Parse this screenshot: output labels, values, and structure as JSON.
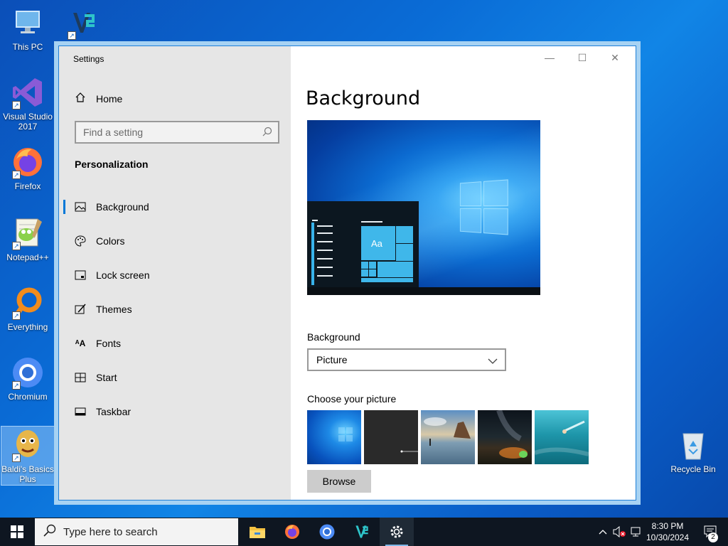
{
  "desktop": {
    "icons": [
      {
        "label": "This PC",
        "icon": "this-pc-icon"
      },
      {
        "label": "Quark",
        "icon": "quark-app-icon"
      },
      {
        "label": "Visual Studio 2017",
        "icon": "visual-studio-icon"
      },
      {
        "label": "Firefox",
        "icon": "firefox-icon"
      },
      {
        "label": "Notepad++",
        "icon": "notepadpp-icon"
      },
      {
        "label": "Everything",
        "icon": "everything-icon"
      },
      {
        "label": "Chromium",
        "icon": "chromium-icon"
      },
      {
        "label": "Baldi's Basics Plus",
        "icon": "baldi-icon"
      },
      {
        "label": "Recycle Bin",
        "icon": "recycle-bin-icon"
      }
    ]
  },
  "window": {
    "app_title": "Settings",
    "controls": {
      "minimize": "—",
      "maximize": "☐",
      "close": "✕"
    }
  },
  "sidebar": {
    "home_label": "Home",
    "search_placeholder": "Find a setting",
    "section_title": "Personalization",
    "items": [
      {
        "label": "Background",
        "icon": "picture-icon",
        "active": true
      },
      {
        "label": "Colors",
        "icon": "palette-icon",
        "active": false
      },
      {
        "label": "Lock screen",
        "icon": "lock-screen-icon",
        "active": false
      },
      {
        "label": "Themes",
        "icon": "brush-icon",
        "active": false
      },
      {
        "label": "Fonts",
        "icon": "font-icon",
        "active": false
      },
      {
        "label": "Start",
        "icon": "start-icon",
        "active": false
      },
      {
        "label": "Taskbar",
        "icon": "taskbar-icon",
        "active": false
      }
    ]
  },
  "main": {
    "title": "Background",
    "preview_tile_text": "Aa",
    "background_label": "Background",
    "background_value": "Picture",
    "choose_label": "Choose your picture",
    "thumbnails": [
      "windows-hero",
      "dark-night",
      "beach-rock",
      "night-sky-tent",
      "underwater-swimmer"
    ],
    "browse_label": "Browse"
  },
  "taskbar": {
    "search_placeholder": "Type here to search",
    "pinned": [
      "file-explorer-icon",
      "firefox-icon",
      "chromium-icon",
      "quark-app-icon",
      "settings-gear-icon"
    ],
    "time": "8:30 PM",
    "date": "10/30/2024",
    "notification_count": "2"
  },
  "colors": {
    "accent": "#0078d7",
    "sidebar_bg": "#e6e6e6",
    "taskbar_bg": "#0e1621"
  }
}
